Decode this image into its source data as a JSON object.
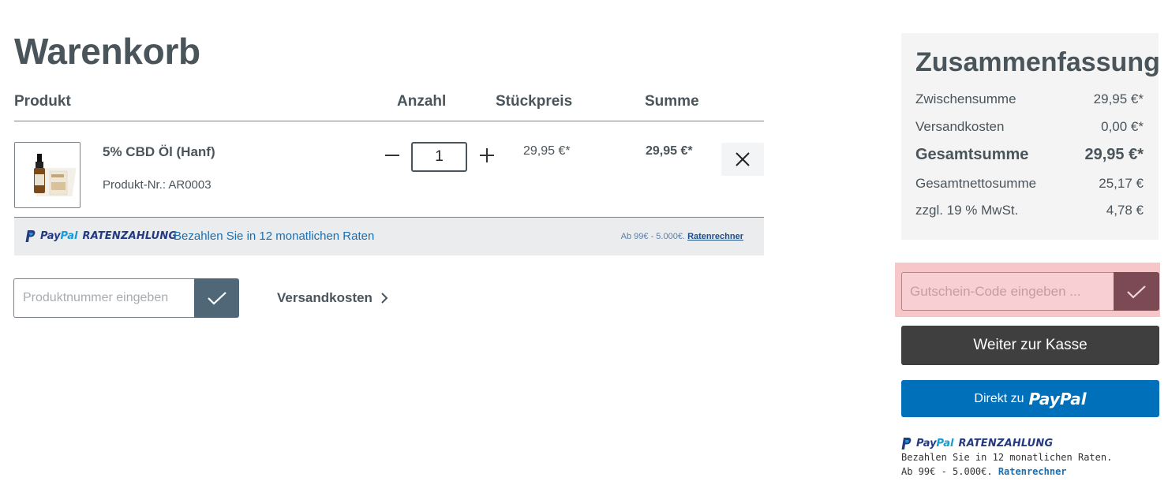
{
  "page": {
    "title": "Warenkorb"
  },
  "table": {
    "headers": {
      "product": "Produkt",
      "quantity": "Anzahl",
      "unit_price": "Stückpreis",
      "total": "Summe"
    }
  },
  "cart_item": {
    "name": "5% CBD Öl (Hanf)",
    "product_number": "Produkt-Nr.: AR0003",
    "quantity": "1",
    "unit_price": "29,95 €*",
    "line_total": "29,95 €*"
  },
  "paypal_bar": {
    "logo_pay": "Pay",
    "logo_pal": "Pal",
    "logo_ratenzahlung": "RATENZAHLUNG",
    "text": "Bezahlen Sie in 12 monatlichen Raten",
    "range_text": "Ab 99€ - 5.000€.",
    "calculator_link": "Ratenrechner"
  },
  "add_product": {
    "placeholder": "Produktnummer eingeben"
  },
  "shipping_link": {
    "label": "Versandkosten"
  },
  "summary": {
    "title": "Zusammenfassung",
    "rows": [
      {
        "label": "Zwischensumme",
        "value": "29,95 €*"
      },
      {
        "label": "Versandkosten",
        "value": "0,00 €*"
      },
      {
        "label": "Gesamtsumme",
        "value": "29,95 €*"
      },
      {
        "label": "Gesamtnettosumme",
        "value": "25,17 €"
      },
      {
        "label": "zzgl. 19 % MwSt.",
        "value": "4,78 €"
      }
    ]
  },
  "voucher": {
    "placeholder": "Gutschein-Code eingeben ..."
  },
  "checkout": {
    "label": "Weiter zur Kasse"
  },
  "paypal_express": {
    "prefix": "Direkt zu",
    "brand": "PayPal"
  },
  "side_paypal": {
    "logo_pay": "Pay",
    "logo_pal": "Pal",
    "logo_ratenzahlung": "RATENZAHLUNG",
    "line1": "Bezahlen Sie in 12 monatlichen Raten.",
    "range_text": "Ab 99€ - 5.000€.",
    "calculator_link": "Ratenrechner"
  },
  "colors": {
    "text": "#4a545b",
    "paypal_blue": "#0070ba",
    "checkout_dark": "#3f3f3f",
    "voucher_highlight": "#f7c6c9",
    "confirm_button": "#4f6777"
  }
}
